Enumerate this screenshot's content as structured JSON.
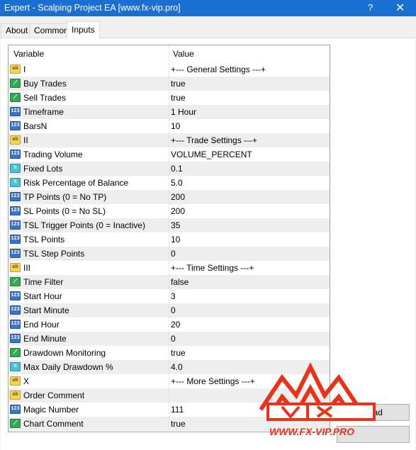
{
  "window": {
    "title": "Expert - Scalping Project EA [www.fx-vip.pro]",
    "help_glyph": "?",
    "close_glyph": "✕"
  },
  "tabs": [
    {
      "label": "About"
    },
    {
      "label": "Common"
    },
    {
      "label": "Inputs",
      "active": true
    }
  ],
  "table": {
    "headers": {
      "variable": "Variable",
      "value": "Value"
    },
    "rows": [
      {
        "type": "ab",
        "icon": "string-icon",
        "name": "I",
        "value": "+--- General Settings ---+"
      },
      {
        "type": "bool",
        "icon": "bool-icon",
        "name": "Buy Trades",
        "value": "true"
      },
      {
        "type": "bool",
        "icon": "bool-icon",
        "name": "Sell Trades",
        "value": "true"
      },
      {
        "type": "int",
        "icon": "integer-icon",
        "name": "Timeframe",
        "value": "1 Hour"
      },
      {
        "type": "int",
        "icon": "integer-icon",
        "name": "BarsN",
        "value": "10"
      },
      {
        "type": "ab",
        "icon": "string-icon",
        "name": "II",
        "value": "+--- Trade Settings ---+"
      },
      {
        "type": "int",
        "icon": "integer-icon",
        "name": "Trading Volume",
        "value": "VOLUME_PERCENT"
      },
      {
        "type": "dbl",
        "icon": "double-icon",
        "name": "Fixed Lots",
        "value": "0.1"
      },
      {
        "type": "dbl",
        "icon": "double-icon",
        "name": "Risk Percentage of Balance",
        "value": "5.0"
      },
      {
        "type": "int",
        "icon": "integer-icon",
        "name": "TP Points (0 = No TP)",
        "value": "200"
      },
      {
        "type": "int",
        "icon": "integer-icon",
        "name": "SL Points (0 = No SL)",
        "value": "200"
      },
      {
        "type": "int",
        "icon": "integer-icon",
        "name": "TSL Trigger Points (0 = Inactive)",
        "value": "35"
      },
      {
        "type": "int",
        "icon": "integer-icon",
        "name": "TSL Points",
        "value": "10"
      },
      {
        "type": "int",
        "icon": "integer-icon",
        "name": "TSL Step Points",
        "value": "0"
      },
      {
        "type": "ab",
        "icon": "string-icon",
        "name": "III",
        "value": "+--- Time Settings ---+"
      },
      {
        "type": "bool",
        "icon": "bool-icon",
        "name": "Time Filter",
        "value": "false"
      },
      {
        "type": "int",
        "icon": "integer-icon",
        "name": "Start Hour",
        "value": "3"
      },
      {
        "type": "int",
        "icon": "integer-icon",
        "name": "Start Minute",
        "value": "0"
      },
      {
        "type": "int",
        "icon": "integer-icon",
        "name": "End Hour",
        "value": "20"
      },
      {
        "type": "int",
        "icon": "integer-icon",
        "name": "End Minute",
        "value": "0"
      },
      {
        "type": "bool",
        "icon": "bool-icon",
        "name": "Drawdown Monitoring",
        "value": "true"
      },
      {
        "type": "dbl",
        "icon": "double-icon",
        "name": "Max Daily Drawdown %",
        "value": "4.0"
      },
      {
        "type": "ab",
        "icon": "string-icon",
        "name": "X",
        "value": "+--- More Settings ---+"
      },
      {
        "type": "ab",
        "icon": "string-icon",
        "name": "Order Comment",
        "value": ""
      },
      {
        "type": "int",
        "icon": "integer-icon",
        "name": "Magic Number",
        "value": "111"
      },
      {
        "type": "bool",
        "icon": "bool-icon",
        "name": "Chart Comment",
        "value": "true"
      }
    ]
  },
  "buttons": {
    "load": "Load"
  },
  "icon_glyphs": {
    "ab": "ab",
    "bool": "⟋",
    "int": "123",
    "dbl": "½"
  },
  "watermark": {
    "text": "WWW.FX-VIP.PRO",
    "color": "#e8331b"
  }
}
